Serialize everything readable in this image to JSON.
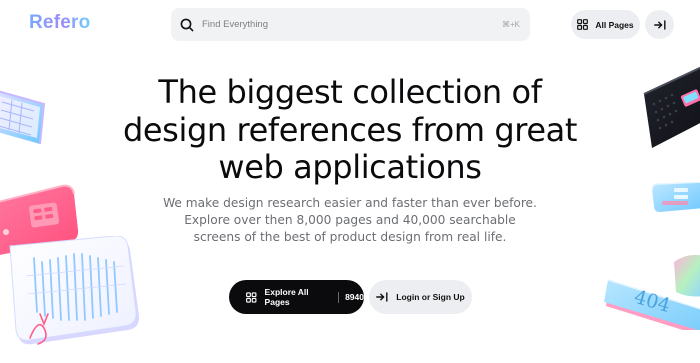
{
  "header": {
    "logo": "Refero",
    "search": {
      "placeholder": "Find Everything",
      "shortcut": "⌘+K"
    },
    "all_pages_label": "All Pages"
  },
  "hero": {
    "title_lines": [
      "The biggest collection of",
      "design references from great",
      "web applications"
    ],
    "subtitle_lines": [
      "We make design research easier and faster than ever before.",
      "Explore over then 8,000 pages and 40,000 searchable",
      "screens of the best of product design from real life."
    ]
  },
  "cta": {
    "explore_label": "Explore All Pages",
    "explore_count": "8940",
    "login_label": "Login or Sign Up"
  },
  "illustrations": {
    "card_404_text": "404"
  },
  "colors": {
    "logo_gradient": [
      "#7aa9ff",
      "#9b8cf6",
      "#6fd0ff"
    ],
    "primary_button": "#0b0b0d",
    "secondary_button": "#eceef1",
    "search_bg": "#f1f2f4"
  }
}
